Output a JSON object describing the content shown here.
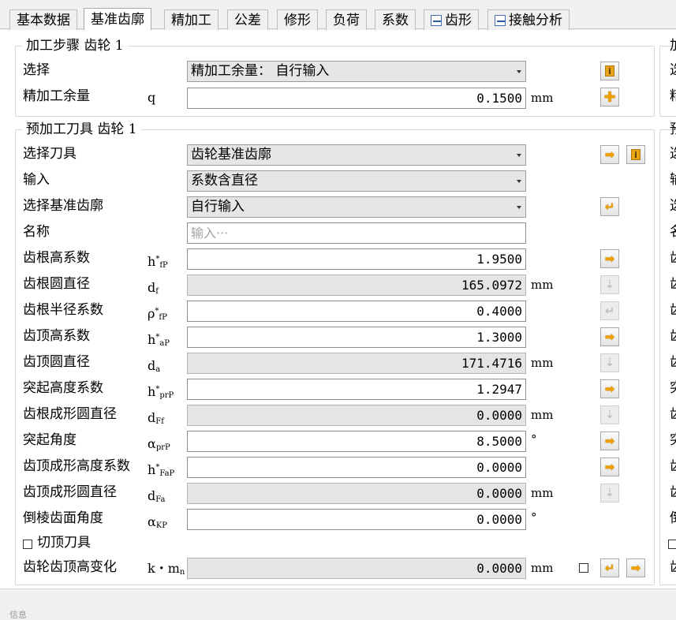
{
  "tabs": [
    {
      "label": "基本数据",
      "active": false
    },
    {
      "label": "基准齿廓",
      "active": true
    },
    {
      "label": "精加工",
      "active": false
    },
    {
      "label": "公差",
      "active": false
    },
    {
      "label": "修形",
      "active": false
    },
    {
      "label": "负荷",
      "active": false
    },
    {
      "label": "系数",
      "active": false
    },
    {
      "label": "齿形",
      "active": false,
      "icon": "document-edit-icon"
    },
    {
      "label": "接触分析",
      "active": false,
      "icon": "document-edit-icon"
    }
  ],
  "machining": {
    "title": "加工步骤 齿轮 1",
    "select_label": "选择",
    "select_value": "精加工余量：  自行输入",
    "allowance_label": "精加工余量",
    "allowance_symbol": "q",
    "allowance_value": "0.1500",
    "allowance_unit": "mm"
  },
  "tool": {
    "title": "预加工刀具 齿轮 1",
    "select_tool_label": "选择刀具",
    "select_tool_value": "齿轮基准齿廓",
    "input_label": "输入",
    "input_value": "系数含直径",
    "profile_label": "选择基准齿廓",
    "profile_value": "自行输入",
    "name_label": "名称",
    "name_placeholder": "输入···",
    "rows": [
      {
        "label": "齿根高系数",
        "sym": "h",
        "sup": "*",
        "sub": "fP",
        "value": "1.9500",
        "unit": "",
        "ro": false
      },
      {
        "label": "齿根圆直径",
        "sym": "d",
        "sup": "",
        "sub": "f",
        "value": "165.0972",
        "unit": "mm",
        "ro": true
      },
      {
        "label": "齿根半径系数",
        "sym": "ρ",
        "sup": "*",
        "sub": "fP",
        "value": "0.4000",
        "unit": "",
        "ro": false
      },
      {
        "label": "齿顶高系数",
        "sym": "h",
        "sup": "*",
        "sub": "aP",
        "value": "1.3000",
        "unit": "",
        "ro": false
      },
      {
        "label": "齿顶圆直径",
        "sym": "d",
        "sup": "",
        "sub": "a",
        "value": "171.4716",
        "unit": "mm",
        "ro": true
      },
      {
        "label": "突起高度系数",
        "sym": "h",
        "sup": "*",
        "sub": "prP",
        "value": "1.2947",
        "unit": "",
        "ro": false
      },
      {
        "label": "齿根成形圆直径",
        "sym": "d",
        "sup": "",
        "sub": "Ff",
        "value": "0.0000",
        "unit": "mm",
        "ro": true
      },
      {
        "label": "突起角度",
        "sym": "α",
        "sup": "",
        "sub": "prP",
        "value": "8.5000",
        "unit": "°",
        "ro": false
      },
      {
        "label": "齿顶成形高度系数",
        "sym": "h",
        "sup": "*",
        "sub": "FaP",
        "value": "0.0000",
        "unit": "",
        "ro": false
      },
      {
        "label": "齿顶成形圆直径",
        "sym": "d",
        "sup": "",
        "sub": "Fa",
        "value": "0.0000",
        "unit": "mm",
        "ro": true
      },
      {
        "label": "倒棱齿面角度",
        "sym": "α",
        "sup": "",
        "sub": "KP",
        "value": "0.0000",
        "unit": "°",
        "ro": false
      }
    ],
    "topping_label": "切顶刀具",
    "addendum_label": "齿轮齿顶高变化",
    "addendum_symbol": "k・m",
    "addendum_sub": "n",
    "addendum_value": "0.0000",
    "addendum_unit": "mm"
  },
  "right_panel_chars": [
    "加",
    "选",
    "精",
    "预",
    "选",
    "输",
    "选",
    "名",
    "齿",
    "齿",
    "齿",
    "齿",
    "齿",
    "突",
    "齿",
    "突",
    "齿",
    "齿",
    "倒",
    "齿"
  ],
  "status": {
    "label": "信息"
  }
}
